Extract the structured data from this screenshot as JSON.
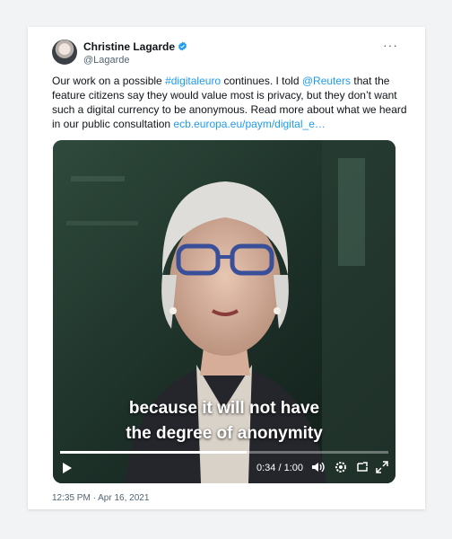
{
  "author": {
    "name": "Christine Lagarde",
    "handle": "@Lagarde",
    "verified_icon": "verified-badge-icon"
  },
  "tweet": {
    "text_1": "Our work on a possible ",
    "hashtag": "#digitaleuro",
    "text_2": " continues. I told ",
    "mention": "@Reuters",
    "text_3": " that the feature citizens say they would value most is privacy, but they don’t want such a digital currency to be anonymous. Read more about what we heard in our public consultation ",
    "url": "ecb.europa.eu/paym/digital_e…"
  },
  "menu": {
    "more_label": "···"
  },
  "video": {
    "subtitle_line_1": "because it will not have",
    "subtitle_line_2": "the degree of anonymity",
    "time": "0:34 / 1:00",
    "progress": 0.567
  },
  "timestamp": "12:35 PM · Apr 16, 2021",
  "colors": {
    "link": "#1d9bf0",
    "verified": "#1d9bf0",
    "text": "#0f1419"
  }
}
